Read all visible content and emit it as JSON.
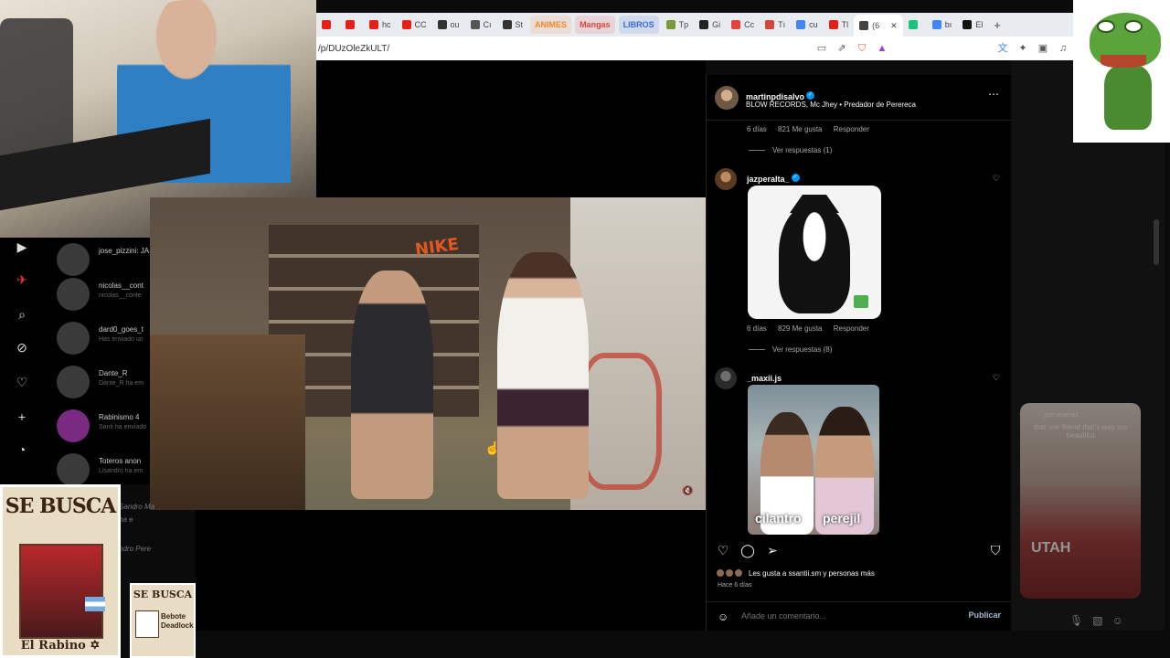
{
  "browser": {
    "tabs": [
      {
        "label": "",
        "color": "#e62117"
      },
      {
        "label": "",
        "color": "#e62117",
        "icon": "music"
      },
      {
        "label": "hc",
        "color": "#e62117"
      },
      {
        "label": "CC",
        "color": "#e62117"
      },
      {
        "label": "ou",
        "color": "#333333"
      },
      {
        "label": "Cı",
        "color": "#555555"
      },
      {
        "label": "St",
        "color": "#333333"
      },
      {
        "label": "ANIMES",
        "color": "#f08a2c",
        "pill": true
      },
      {
        "label": "Mangas",
        "color": "#e0443a",
        "pill": true
      },
      {
        "label": "LIBROS",
        "color": "#3a6bd6",
        "pill": true
      },
      {
        "label": "Tp",
        "color": "#7a9a3a"
      },
      {
        "label": "Gi",
        "color": "#222222"
      },
      {
        "label": "Cc",
        "color": "#e0443a"
      },
      {
        "label": "Tı",
        "color": "#d44638"
      },
      {
        "label": "cu",
        "color": "#4285f4"
      },
      {
        "label": "Tl",
        "color": "#e62117"
      },
      {
        "label": "(6",
        "color": "#444444",
        "active": true
      },
      {
        "label": "",
        "color": "#19c37d"
      },
      {
        "label": "bı",
        "color": "#4285f4"
      },
      {
        "label": "El",
        "color": "#111111"
      }
    ],
    "url": "/p/DUzOleZkULT/"
  },
  "instagram": {
    "dm_list": [
      {
        "name": "jose_pizzini: JA",
        "sub": ""
      },
      {
        "name": "nicolas__cont",
        "sub": "nicolas__conte"
      },
      {
        "name": "dard0_goes_t",
        "sub": "Has enviado un"
      },
      {
        "name": "Dante_R",
        "sub": "Dante_R ha em"
      },
      {
        "name": "Rabinismo 4",
        "sub": "Santi ha enviado"
      },
      {
        "name": "Toteros anon",
        "sub": "Lisandro ha em"
      }
    ],
    "dm_extra": [
      "Sandro Ma",
      "ha e",
      "ndro Pere"
    ],
    "post": {
      "author": "martinpdisalvo",
      "subtitle": "BLOW RECORDS, Mc Jhey • Predador de Perereca",
      "first_meta": {
        "age": "6 días",
        "likes": "821 Me gusta",
        "reply": "Responder"
      },
      "first_replies": "Ver respuestas (1)",
      "comments": [
        {
          "user": "jazperalta_",
          "verified": true,
          "age": "6 días",
          "likes": "829 Me gusta",
          "reply": "Responder",
          "replies": "Ver respuestas (8)"
        },
        {
          "user": "_maxii.js",
          "verified": false,
          "caption_left": "cilantro",
          "caption_right": "perejil"
        }
      ],
      "liked_by": "Les gusta a ssantii.sm y personas más",
      "date": "Hace 6 días",
      "comment_placeholder": "Añade un comentario...",
      "publish": "Publicar"
    }
  },
  "right_reel": {
    "user": "josh.morris1",
    "caption": "that one friend that's way too beautiful",
    "shirt": "UTAH"
  },
  "overlays": {
    "wanted_title": "SE BUSCA",
    "wanted1_name": "El Rabino ✡",
    "wanted2_title": "SE BUSCA",
    "wanted2_name": "Bebote Deadlock"
  },
  "video": {
    "brand": "NIKE",
    "muted": true
  }
}
